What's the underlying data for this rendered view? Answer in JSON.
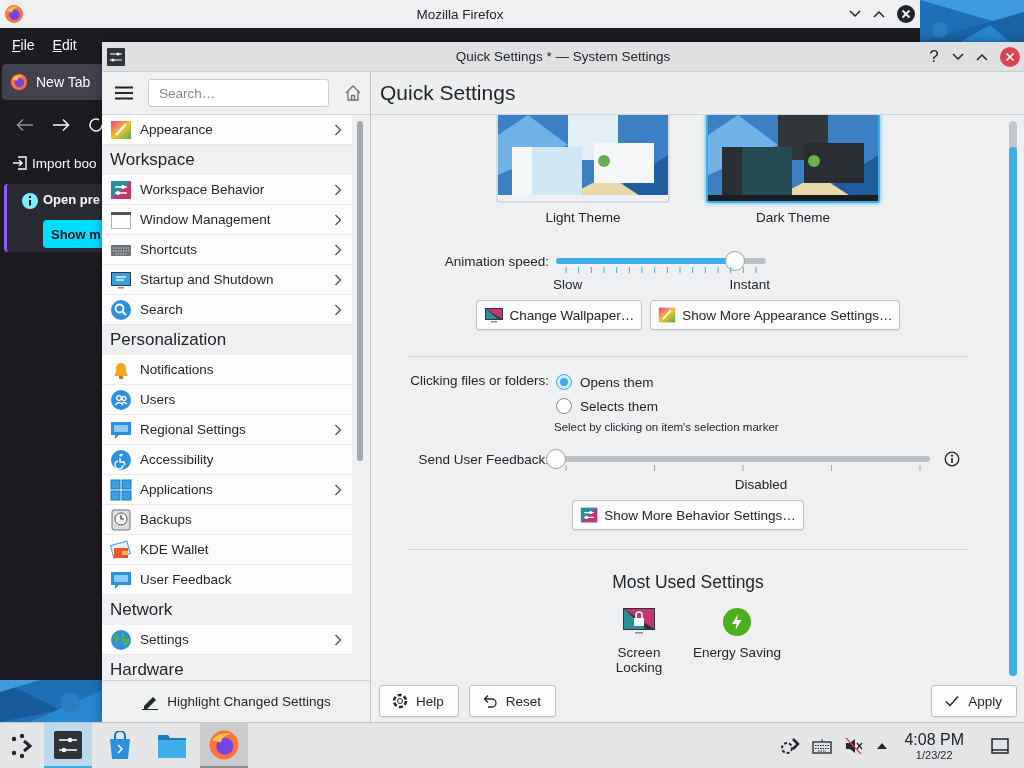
{
  "firefox": {
    "title": "Mozilla Firefox",
    "menu": [
      "File",
      "Edit"
    ],
    "tab": {
      "label": "New Tab",
      "selected": true
    },
    "import_link": "Import boo",
    "notice": {
      "title": "Open pre",
      "button": "Show m"
    }
  },
  "settings": {
    "title": "Quick Settings * — System Settings",
    "help_button": "?",
    "search": {
      "placeholder": "Search…"
    },
    "sidebar": [
      {
        "kind": "item",
        "label": "Appearance",
        "submenu": true
      },
      {
        "kind": "header",
        "label": "Workspace"
      },
      {
        "kind": "item",
        "label": "Workspace Behavior",
        "submenu": true
      },
      {
        "kind": "item",
        "label": "Window Management",
        "submenu": true
      },
      {
        "kind": "item",
        "label": "Shortcuts",
        "submenu": true
      },
      {
        "kind": "item",
        "label": "Startup and Shutdown",
        "submenu": true
      },
      {
        "kind": "item",
        "label": "Search",
        "submenu": true
      },
      {
        "kind": "header",
        "label": "Personalization"
      },
      {
        "kind": "item",
        "label": "Notifications",
        "submenu": false
      },
      {
        "kind": "item",
        "label": "Users",
        "submenu": false
      },
      {
        "kind": "item",
        "label": "Regional Settings",
        "submenu": true
      },
      {
        "kind": "item",
        "label": "Accessibility",
        "submenu": false
      },
      {
        "kind": "item",
        "label": "Applications",
        "submenu": true
      },
      {
        "kind": "item",
        "label": "Backups",
        "submenu": false
      },
      {
        "kind": "item",
        "label": "KDE Wallet",
        "submenu": false
      },
      {
        "kind": "item",
        "label": "User Feedback",
        "submenu": false
      },
      {
        "kind": "header",
        "label": "Network"
      },
      {
        "kind": "item",
        "label": "Settings",
        "submenu": true
      },
      {
        "kind": "header",
        "label": "Hardware"
      }
    ],
    "highlight_button": "Highlight Changed Settings",
    "page_title": "Quick Settings",
    "themes": [
      {
        "label": "Light Theme",
        "selected": false
      },
      {
        "label": "Dark Theme",
        "selected": true
      }
    ],
    "animation_speed": {
      "label": "Animation speed:",
      "level": 0.85,
      "min_label": "Slow",
      "max_label": "Instant"
    },
    "appearance_buttons": [
      "Change Wallpaper…",
      "Show More Appearance Settings…"
    ],
    "click_behavior": {
      "label": "Clicking files or folders:",
      "options": [
        {
          "label": "Opens them",
          "selected": true
        },
        {
          "label": "Selects them",
          "selected": false
        }
      ],
      "hint": "Select by clicking on item's selection marker"
    },
    "feedback": {
      "label": "Send User Feedback:",
      "level": 0,
      "reading": "Disabled"
    },
    "behavior_button": "Show More Behavior Settings…",
    "most_used": {
      "title": "Most Used Settings",
      "items": [
        {
          "label": "Screen Locking"
        },
        {
          "label": "Energy Saving"
        }
      ]
    },
    "buttons": [
      "Help",
      "Reset",
      "Apply"
    ]
  },
  "taskbar": {
    "tasks": [
      {
        "selected": true,
        "running": true
      },
      {
        "selected": false,
        "running": false
      },
      {
        "selected": false,
        "running": false
      },
      {
        "selected": false,
        "running": true
      }
    ],
    "clock": {
      "time": "4:08 PM",
      "date": "1/23/22"
    }
  }
}
